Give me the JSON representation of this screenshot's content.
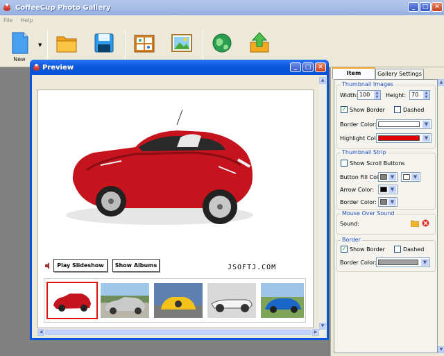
{
  "app": {
    "title": "CoffeeCup Photo Gallery",
    "menu": [
      "File",
      "Help"
    ]
  },
  "toolbar": {
    "buttons": [
      {
        "label": "New",
        "icon": "new-file-icon"
      },
      {
        "label": "",
        "icon": "open-folder-icon"
      },
      {
        "label": "",
        "icon": "save-disk-icon"
      },
      {
        "label": "",
        "icon": "albums-icon"
      },
      {
        "label": "",
        "icon": "theme-image-icon"
      },
      {
        "label": "",
        "icon": "preview-globe-icon"
      },
      {
        "label": "",
        "icon": "upload-icon"
      }
    ]
  },
  "preview": {
    "title": "Preview",
    "play_slideshow": "Play Slideshow",
    "show_albums": "Show Albums",
    "watermark": "JSOFTJ.COM",
    "thumbnails": [
      "red convertible",
      "silver convertible",
      "yellow car",
      "vintage roadster",
      "blue car"
    ]
  },
  "panel": {
    "tabs": [
      "Item Settings",
      "Gallery Settings"
    ],
    "thumbnail_images": {
      "title": "Thumbnail Images",
      "width_label": "Width:",
      "width_value": "100",
      "height_label": "Height:",
      "height_value": "70",
      "show_border": "Show Border",
      "dashed": "Dashed",
      "border_color_label": "Border Color:",
      "border_color": "#ffffff",
      "highlight_color_label": "Highlight Color:",
      "highlight_color": "#e00000"
    },
    "thumbnail_strip": {
      "title": "Thumbnail Strip",
      "show_scroll_buttons": "Show Scroll Buttons",
      "button_fill_label": "Button Fill Color:",
      "button_fill_color": "#808080",
      "button_fill_color2": "#ffffff",
      "arrow_color_label": "Arrow Color:",
      "arrow_color": "#000000",
      "border_color_label": "Border Color:",
      "border_color": "#808080"
    },
    "mouse_over_sound": {
      "title": "Mouse Over Sound",
      "sound_label": "Sound:"
    },
    "border": {
      "title": "Border",
      "show_border": "Show Border",
      "dashed": "Dashed",
      "border_color_label": "Border Color:",
      "border_color": "#a0a0a0"
    }
  }
}
